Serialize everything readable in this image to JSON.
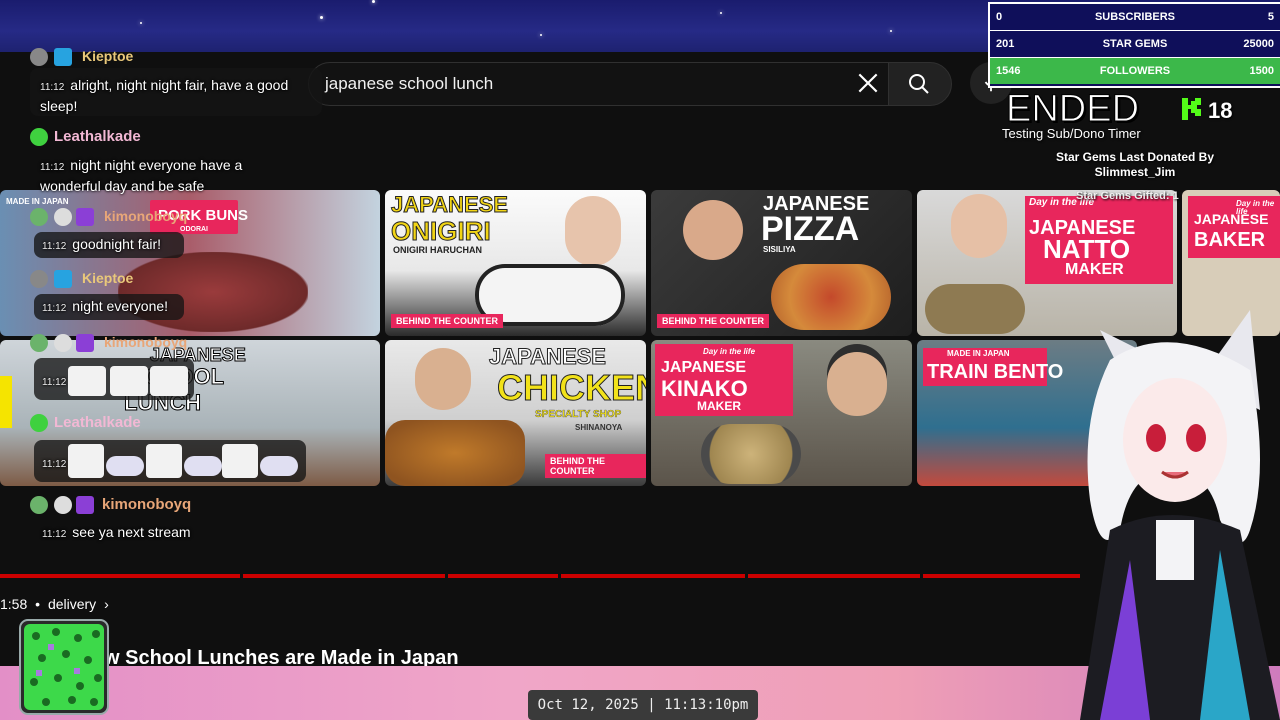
{
  "search": {
    "query": "japanese school lunch"
  },
  "thumbnails": {
    "row1": [
      {
        "lines": [
          "MADE IN JAPAN",
          "PORK BUNS",
          "ODORAI"
        ]
      },
      {
        "lines": [
          "JAPANESE",
          "ONIGIRI",
          "ONIGIRI HARUCHAN"
        ],
        "tag": "BEHIND THE COUNTER"
      },
      {
        "lines": [
          "JAPANESE",
          "PIZZA",
          "SISILIYA"
        ],
        "tag": "BEHIND THE COUNTER"
      },
      {
        "lines": [
          "Day in the life",
          "JAPANESE",
          "NATTO",
          "MAKER"
        ]
      },
      {
        "lines": [
          "Day in the life",
          "JAPANESE",
          "BAKER"
        ]
      }
    ],
    "row2": [
      {
        "lines": [
          "JAPANESE",
          "SCHOOL",
          "LUNCH"
        ]
      },
      {
        "lines": [
          "JAPANESE",
          "CHICKEN",
          "SPECIALTY SHOP",
          "SHINANOYA"
        ],
        "tag": "BEHIND THE COUNTER"
      },
      {
        "lines": [
          "Day in the life",
          "JAPANESE",
          "KINAKO",
          "MAKER"
        ]
      },
      {
        "lines": [
          "MADE IN JAPAN",
          "TRAIN BENTO"
        ]
      }
    ]
  },
  "chat": [
    {
      "user": "Kieptoe",
      "time": "11:12",
      "text": "alright, night night fair, have a good sleep!"
    },
    {
      "user": "Leathalkade",
      "time": "11:12",
      "text": "night night everyone have a wonderful day and be safe"
    },
    {
      "user": "kimonoboyq",
      "time": "11:12",
      "text": "goodnight fair!"
    },
    {
      "user": "Kieptoe",
      "time": "11:12",
      "text": "night everyone!"
    },
    {
      "user": "kimonoboyq",
      "time": "11:12",
      "text": ""
    },
    {
      "user": "Leathalkade",
      "time": "11:12",
      "text": ""
    },
    {
      "user": "kimonoboyq",
      "time": "11:12",
      "text": "see ya next stream"
    }
  ],
  "counter": {
    "rows": [
      {
        "left": "0",
        "label": "SUBSCRIBERS",
        "right": "5",
        "color": "#0f0f5a"
      },
      {
        "left": "201",
        "label": "STAR GEMS",
        "right": "25000",
        "color": "#0f0f5a"
      },
      {
        "left": "1546",
        "label": "FOLLOWERS",
        "right": "1500",
        "color": "#3cb84a"
      }
    ]
  },
  "timer": {
    "status": "ENDED",
    "subtitle": "Testing Sub/Dono Timer",
    "donated_title": "Star Gems Last Donated By",
    "donated_user": "Slimmest_Jim",
    "gifted": "Star Gems Gifted: 1",
    "kick_count": "18"
  },
  "video": {
    "duration_fragment": "1:58",
    "channel": "delivery",
    "title": "w School Lunches are Made in Japan"
  },
  "clock": {
    "text": "Oct 12, 2025 | 11:13:10pm"
  },
  "colors": {
    "progress": "#cc0000",
    "kick_green": "#53fc18",
    "followers_bar": "#3cb84a"
  }
}
